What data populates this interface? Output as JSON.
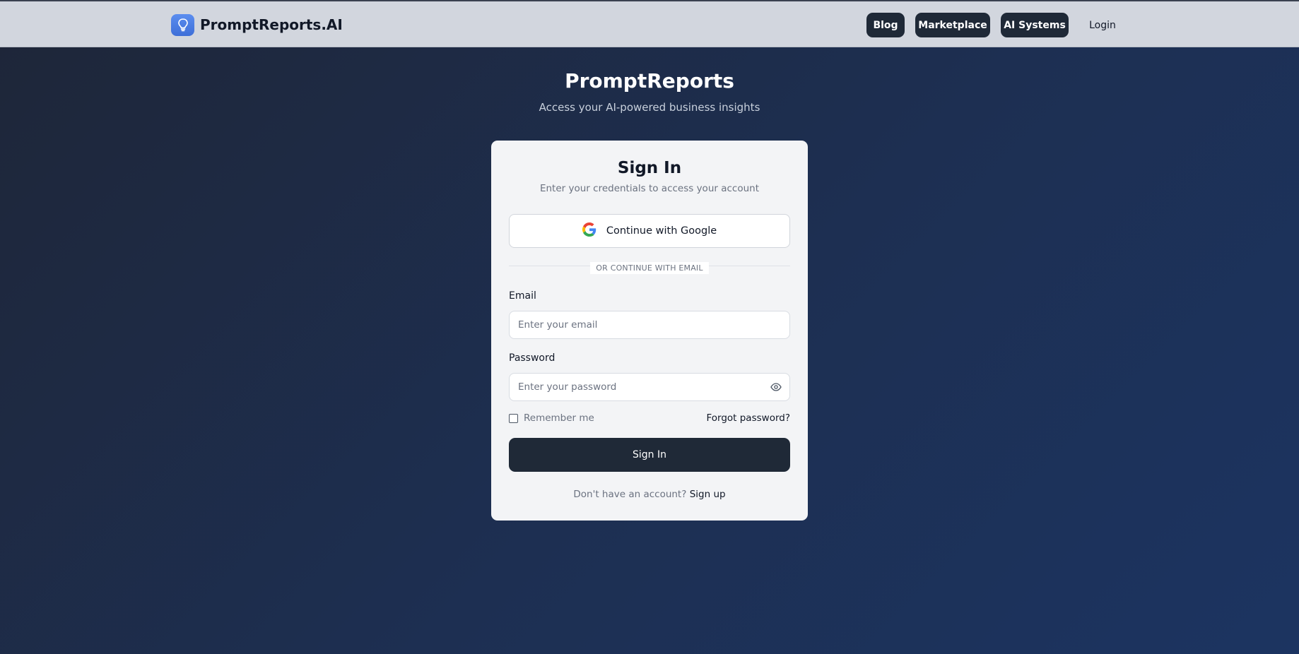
{
  "header": {
    "brand_name": "PromptReports.AI",
    "brand_icon": "lightbulb-icon",
    "nav": [
      {
        "label": "Blog"
      },
      {
        "label": "Marketplace"
      },
      {
        "label": "AI Systems"
      }
    ],
    "login_label": "Login"
  },
  "hero": {
    "title": "PromptReports",
    "subtitle": "Access your AI-powered business insights"
  },
  "card": {
    "title": "Sign In",
    "subtitle": "Enter your credentials to access your account",
    "google_label": "Continue with Google",
    "divider": "OR CONTINUE WITH EMAIL",
    "email": {
      "label": "Email",
      "placeholder": "Enter your email",
      "value": ""
    },
    "password": {
      "label": "Password",
      "placeholder": "Enter your password",
      "value": "",
      "toggle_icon": "eye-icon"
    },
    "remember_label": "Remember me",
    "remember_checked": false,
    "forgot_label": "Forgot password?",
    "submit_label": "Sign In",
    "signup_prompt": "Don't have an account?",
    "signup_link": "Sign up"
  },
  "colors": {
    "primary": "#1f2937",
    "brand_logo": "#4a7ee3",
    "background_start": "#1e2638",
    "background_end": "#1c3461",
    "card_bg": "#f3f4f6"
  }
}
